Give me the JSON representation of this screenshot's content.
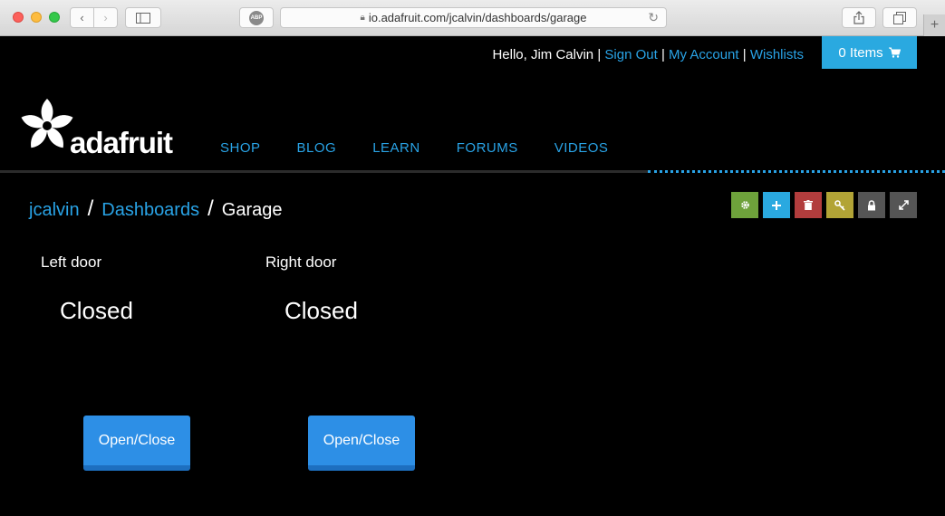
{
  "browser": {
    "url": "io.adafruit.com/jcalvin/dashboards/garage",
    "abp_label": "ABP"
  },
  "header": {
    "greeting": "Hello, Jim Calvin",
    "sign_out": "Sign Out",
    "my_account": "My Account",
    "wishlists": "Wishlists",
    "separator": "|",
    "cart_label": "0 Items"
  },
  "logo": {
    "text": "adafruit"
  },
  "nav": {
    "items": [
      {
        "label": "SHOP"
      },
      {
        "label": "BLOG"
      },
      {
        "label": "LEARN"
      },
      {
        "label": "FORUMS"
      },
      {
        "label": "VIDEOS"
      }
    ]
  },
  "breadcrumb": {
    "user": "jcalvin",
    "section": "Dashboards",
    "current": "Garage",
    "slash": "/"
  },
  "toolbar": {
    "colors": {
      "settings": "#6ea23b",
      "add": "#2aa9e0",
      "delete": "#b23d3d",
      "key": "#b2a436",
      "lock": "#555555",
      "fullscreen": "#555555"
    }
  },
  "blocks": [
    {
      "label": "Left door",
      "value": "Closed",
      "button": "Open/Close"
    },
    {
      "label": "Right door",
      "value": "Closed",
      "button": "Open/Close"
    }
  ]
}
